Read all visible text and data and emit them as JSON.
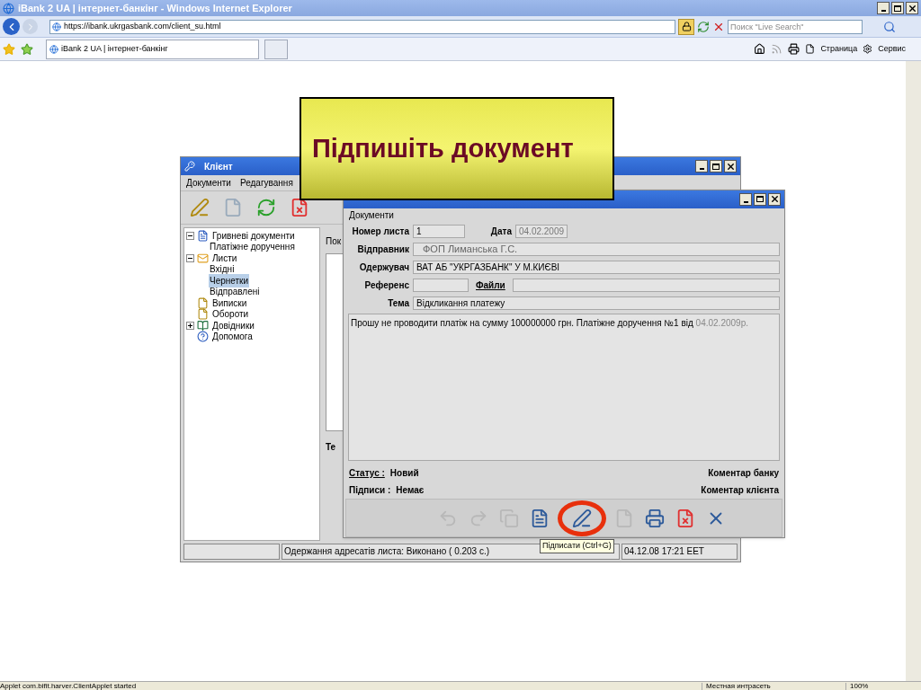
{
  "browser": {
    "title": "iBank 2 UA | інтернет-банкінг - Windows Internet Explorer",
    "url": "https://ibank.ukrgasbank.com/client_su.html",
    "search_placeholder": "Поиск \"Live Search\"",
    "tab_title": "iBank 2 UA | інтернет-банкінг",
    "commands": [
      "Страница",
      "Сервис"
    ],
    "status_text": "Applet com.bifit.harver.ClientApplet started",
    "zone": "Местная интрасеть",
    "zoom": "100%"
  },
  "callout": {
    "text": "Підпишіть документ"
  },
  "client": {
    "title": "Клієнт",
    "menu": [
      "Документи",
      "Редагування"
    ],
    "tree": [
      {
        "label": "Гривневі документи",
        "kind": "doc",
        "expanded": true,
        "selected": false,
        "children": [
          {
            "label": "Платіжне доручення",
            "selected": false
          }
        ]
      },
      {
        "label": "Листи",
        "kind": "mail",
        "expanded": true,
        "selected": false,
        "children": [
          {
            "label": "Вхідні",
            "selected": false
          },
          {
            "label": "Чернетки",
            "selected": true
          },
          {
            "label": "Відправлені",
            "selected": false
          }
        ]
      },
      {
        "label": "Виписки",
        "kind": "report",
        "selected": false
      },
      {
        "label": "Обороти",
        "kind": "report",
        "selected": false
      },
      {
        "label": "Довідники",
        "kind": "books",
        "expanded": false,
        "selected": false
      },
      {
        "label": "Допомога",
        "kind": "help",
        "selected": false
      }
    ],
    "partial_labels": [
      "Пок",
      "Те"
    ],
    "status": {
      "message": "Одержання адресатів листа: Виконано ( 0.203 с.)",
      "time": "04.12.08 17:21 EET"
    }
  },
  "editor": {
    "menu": [
      "Документи"
    ],
    "number": {
      "label": "Номер листа",
      "value": "1"
    },
    "date": {
      "label": "Дата",
      "value": "04.02.2009"
    },
    "sender": {
      "label": "Відправник",
      "value": "ФОП Лиманська Г.С."
    },
    "recipient": {
      "label": "Одержувач",
      "value": "ВАТ АБ \"УКРГАЗБАНК\" У М.КИЄВІ"
    },
    "reference": {
      "label": "Референс",
      "files_link": "Файли"
    },
    "subject": {
      "label": "Тема",
      "value": "Відкликання платежу"
    },
    "body": "Прошу не проводити платіж на сумму 100000000 грн. Платіжне доручення №1 від",
    "body_date": "04.02.2009р.",
    "status_label": "Статус :",
    "status_value": "Новий",
    "signatures_label": "Підписи :",
    "signatures_value": "Немає",
    "bank_comment": "Коментар банку",
    "client_comment": "Коментар клієнта",
    "toolbar": [
      {
        "kind": "undo",
        "disabled": true
      },
      {
        "kind": "redo",
        "disabled": true
      },
      {
        "kind": "copy",
        "disabled": true
      },
      {
        "kind": "edit",
        "disabled": false
      },
      {
        "kind": "sign",
        "disabled": false,
        "highlighted": true
      },
      {
        "kind": "document",
        "disabled": true
      },
      {
        "kind": "print",
        "disabled": false
      },
      {
        "kind": "delete",
        "disabled": false
      },
      {
        "kind": "close",
        "disabled": false
      }
    ],
    "tooltip": "Підписати (Ctrl+G)"
  }
}
